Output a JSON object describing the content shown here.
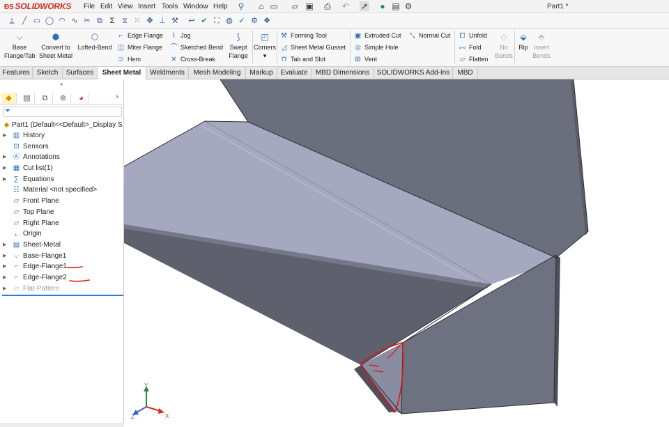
{
  "titlebar": {
    "logo": "SOLIDWORKS",
    "menu": [
      "File",
      "Edit",
      "View",
      "Insert",
      "Tools",
      "Window",
      "Help"
    ],
    "document_title": "Part1 *",
    "icons": [
      "home-icon",
      "new-doc-icon",
      "open-icon",
      "save-icon",
      "print-icon",
      "undo-icon",
      "select-icon",
      "rebuild-icon",
      "file-properties-icon",
      "options-icon"
    ]
  },
  "ribbon": {
    "big": [
      {
        "id": "base-flange",
        "line1": "Base",
        "line2": "Flange/Tab",
        "enabled": true
      },
      {
        "id": "convert",
        "line1": "Convert to",
        "line2": "Sheet Metal",
        "enabled": true
      },
      {
        "id": "lofted",
        "line1": "Lofted-Bend",
        "line2": "",
        "enabled": true
      },
      {
        "id": "swept",
        "line1": "Swept",
        "line2": "Flange",
        "enabled": true
      },
      {
        "id": "corners",
        "line1": "Corners",
        "line2": "",
        "enabled": true
      },
      {
        "id": "no-bends",
        "line1": "No",
        "line2": "Bends",
        "enabled": false
      },
      {
        "id": "rip",
        "line1": "Rip",
        "line2": "",
        "enabled": true
      },
      {
        "id": "insert-bends",
        "line1": "Insert",
        "line2": "Bends",
        "enabled": false
      }
    ],
    "small": [
      {
        "id": "edge-flange",
        "label": "Edge Flange"
      },
      {
        "id": "miter-flange",
        "label": "Miter Flange"
      },
      {
        "id": "hem",
        "label": "Hem"
      },
      {
        "id": "jog",
        "label": "Jog"
      },
      {
        "id": "sketched-bend",
        "label": "Sketched Bend"
      },
      {
        "id": "cross-break",
        "label": "Cross-Break"
      },
      {
        "id": "forming-tool",
        "label": "Forming Tool"
      },
      {
        "id": "sheet-metal-gusset",
        "label": "Sheet Metal Gusset"
      },
      {
        "id": "tab-and-slot",
        "label": "Tab and Slot"
      },
      {
        "id": "extruded-cut",
        "label": "Extruded Cut"
      },
      {
        "id": "simple-hole",
        "label": "Simple Hole"
      },
      {
        "id": "vent",
        "label": "Vent"
      },
      {
        "id": "normal-cut",
        "label": "Normal Cut"
      },
      {
        "id": "unfold",
        "label": "Unfold"
      },
      {
        "id": "fold",
        "label": "Fold"
      },
      {
        "id": "flatten",
        "label": "Flatten"
      }
    ]
  },
  "tabs": [
    {
      "label": "Features",
      "active": false
    },
    {
      "label": "Sketch",
      "active": false
    },
    {
      "label": "Surfaces",
      "active": false
    },
    {
      "label": "Sheet Metal",
      "active": true
    },
    {
      "label": "Weldments",
      "active": false
    },
    {
      "label": "Mesh Modeling",
      "active": false
    },
    {
      "label": "Markup",
      "active": false
    },
    {
      "label": "Evaluate",
      "active": false
    },
    {
      "label": "MBD Dimensions",
      "active": false
    },
    {
      "label": "SOLIDWORKS Add-Ins",
      "active": false
    },
    {
      "label": "MBD",
      "active": false
    }
  ],
  "feature_tree": {
    "root": "Part1  (Default<<Default>_Display S",
    "items": [
      {
        "label": "History",
        "icon": "history-folder-icon",
        "expandable": true,
        "dim": false
      },
      {
        "label": "Sensors",
        "icon": "sensors-icon",
        "expandable": false,
        "dim": false
      },
      {
        "label": "Annotations",
        "icon": "annotations-icon",
        "expandable": true,
        "dim": false
      },
      {
        "label": "Cut list(1)",
        "icon": "cut-list-icon",
        "expandable": true,
        "dim": false
      },
      {
        "label": "Equations",
        "icon": "equations-icon",
        "expandable": true,
        "dim": false
      },
      {
        "label": "Material <not specified>",
        "icon": "material-icon",
        "expandable": false,
        "dim": false
      },
      {
        "label": "Front Plane",
        "icon": "plane-icon",
        "expandable": false,
        "dim": false
      },
      {
        "label": "Top Plane",
        "icon": "plane-icon",
        "expandable": false,
        "dim": false
      },
      {
        "label": "Right Plane",
        "icon": "plane-icon",
        "expandable": false,
        "dim": false
      },
      {
        "label": "Origin",
        "icon": "origin-icon",
        "expandable": false,
        "dim": false
      },
      {
        "label": "Sheet-Metal",
        "icon": "sheet-metal-icon",
        "expandable": true,
        "dim": false
      },
      {
        "label": "Base-Flange1",
        "icon": "base-flange-icon",
        "expandable": true,
        "dim": false
      },
      {
        "label": "Edge-Flange1",
        "icon": "edge-flange-icon",
        "expandable": true,
        "dim": false
      },
      {
        "label": "Edge-Flange2",
        "icon": "edge-flange-icon",
        "expandable": true,
        "dim": false
      },
      {
        "label": "Flat-Pattern",
        "icon": "flat-pattern-icon",
        "expandable": true,
        "dim": true
      }
    ]
  },
  "triad": {
    "x": "X",
    "y": "Y",
    "z": "Z"
  },
  "colors": {
    "accent_red": "#d52b1e",
    "rollback_blue": "#2a7fd4",
    "model_top": "#a4a7bd",
    "model_side": "#5f6170",
    "model_wall": "#6d707e",
    "annotation_red": "#e01010"
  }
}
